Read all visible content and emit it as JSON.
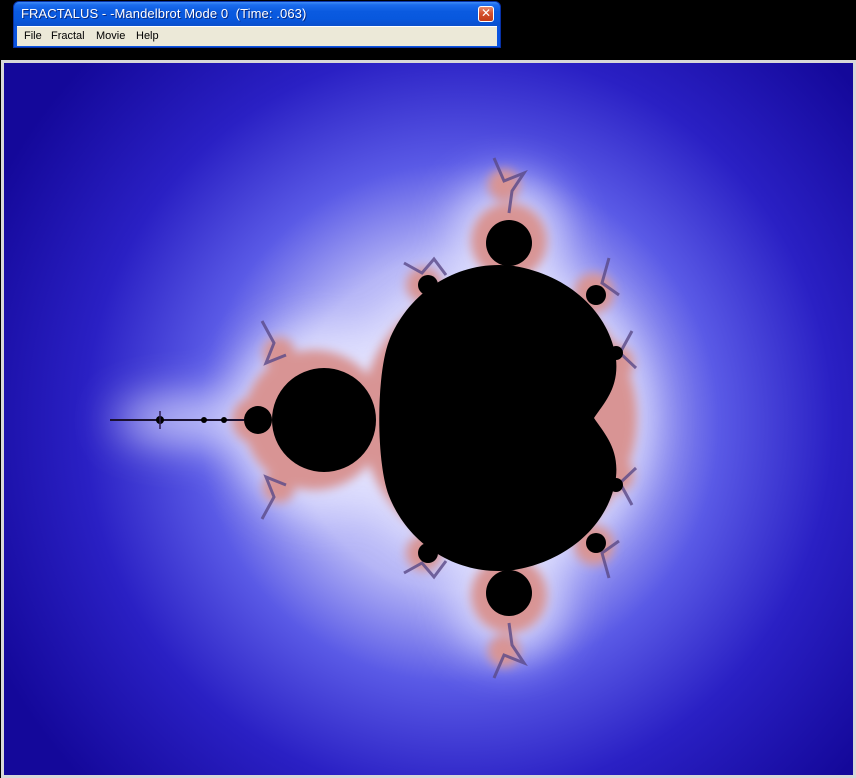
{
  "window": {
    "title": "FRACTALUS - -Mandelbrot Mode 0  (Time: .063)",
    "close_glyph": "✕"
  },
  "menu": {
    "items": [
      {
        "label": "File"
      },
      {
        "label": "Fractal"
      },
      {
        "label": "Movie"
      },
      {
        "label": "Help"
      }
    ]
  },
  "canvas": {
    "subject": "mandelbrot-set",
    "colors": {
      "background_outer": "#14089a",
      "background_mid": "#3838d8",
      "halo": "#c8c8ff",
      "fringe": "#d89090",
      "set": "#000000",
      "frame": "#d8d8d8"
    }
  }
}
